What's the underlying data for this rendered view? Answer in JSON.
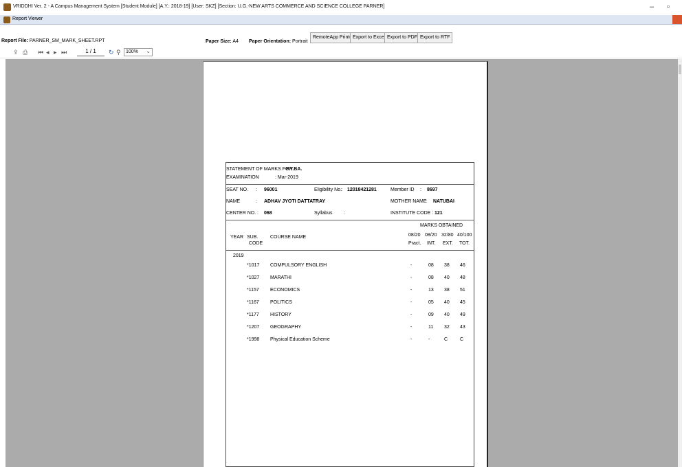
{
  "window": {
    "title": "VRIDDHI Ver. 2 - A Campus Management System [Student Module] [A.Y.: 2018-19] [User: SKZ] [Section: U.G.-NEW ARTS COMMERCE AND SCIENCE COLLEGE PARNER]",
    "minimize": "–",
    "maximize": "▫"
  },
  "report_viewer": {
    "label": "Report Viewer"
  },
  "info": {
    "report_file_label": "Report File:",
    "report_file": "PARNER_SM_MARK_SHEET.RPT",
    "paper_size_label": "Paper Size:",
    "paper_size": "A4",
    "paper_orientation_label": "Paper Orientation:",
    "paper_orientation": "Portrait",
    "buttons": {
      "remote": "RemoteApp Printer",
      "excel": "Export to Excel",
      "pdf": "Export to PDF",
      "rtf": "Export to RTF"
    }
  },
  "toolbar": {
    "page": "1 / 1",
    "zoom": "100%"
  },
  "marksheet": {
    "stmt_label": "STATEMENT OF MARKS FOR :",
    "class": "F.Y.BA.",
    "exam_label": "EXAMINATION",
    "exam_value": ": Mar-2019",
    "seat_label": "SEAT NO.",
    "seat_value": "96001",
    "elig_label": "Eligibility No.",
    "elig_value": "12018421281",
    "member_label": "Member ID",
    "member_value": "8697",
    "name_label": "NAME",
    "name_value": "ADHAV JYOTI DATTATRAY",
    "mother_label": "MOTHER NAME",
    "mother_value": "NATUBAI",
    "center_label": "CENTER NO.",
    "center_value": "068",
    "syllabus_label": "Syllabus",
    "syllabus_value": "",
    "inst_label": "INSTITUTE CODE :",
    "inst_value": "121",
    "marks_obtained": "MARKS OBTAINED",
    "hdr_year": "YEAR",
    "hdr_sub": "SUB.",
    "hdr_code": "CODE",
    "hdr_course": "COURSE NAME",
    "max_prac": "08/20",
    "max_int": "08/20",
    "max_ext": "32/80",
    "max_tot": "40/100",
    "hdr_prac": "Pract.",
    "hdr_int": "INT.",
    "hdr_ext": "EXT.",
    "hdr_tot": "TOT.",
    "year": "2019",
    "rows": [
      {
        "code": "*1017",
        "course": "COMPULSORY ENGLISH",
        "prac": "-",
        "int": "08",
        "ext": "38",
        "tot": "46"
      },
      {
        "code": "*1027",
        "course": "MARATHI",
        "prac": "-",
        "int": "08",
        "ext": "40",
        "tot": "48"
      },
      {
        "code": "*1157",
        "course": "ECONOMICS",
        "prac": "-",
        "int": "13",
        "ext": "38",
        "tot": "51"
      },
      {
        "code": "*1167",
        "course": "POLITICS",
        "prac": "-",
        "int": "05",
        "ext": "40",
        "tot": "45"
      },
      {
        "code": "*1177",
        "course": "HISTORY",
        "prac": "-",
        "int": "09",
        "ext": "40",
        "tot": "49"
      },
      {
        "code": "*1207",
        "course": "GEOGRAPHY",
        "prac": "-",
        "int": "11",
        "ext": "32",
        "tot": "43"
      },
      {
        "code": "*1998",
        "course": "Physical Education Scheme",
        "prac": "-",
        "int": "-",
        "ext": "C",
        "tot": "C"
      }
    ]
  }
}
